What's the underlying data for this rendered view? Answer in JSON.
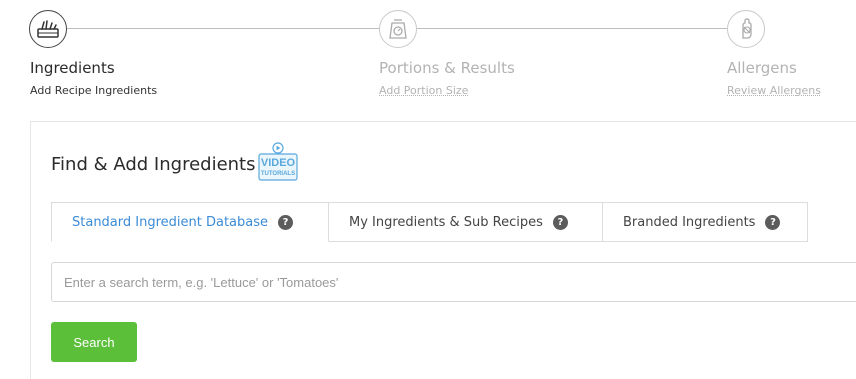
{
  "stepper": {
    "steps": [
      {
        "title": "Ingredients",
        "subtitle": "Add Recipe Ingredients",
        "icon": "chef-board-icon",
        "state": "active"
      },
      {
        "title": "Portions & Results",
        "subtitle": "Add Portion Size",
        "icon": "scale-icon",
        "state": "inactive"
      },
      {
        "title": "Allergens",
        "subtitle": "Review Allergens",
        "icon": "allergen-hand-icon",
        "state": "inactive"
      }
    ]
  },
  "finder": {
    "title": "Find & Add Ingredients",
    "video_badge": {
      "line1": "VIDEO",
      "line2": "TUTORIALS",
      "icon": "play-icon"
    },
    "tabs": [
      {
        "label": "Standard Ingredient Database",
        "active": true
      },
      {
        "label": "My Ingredients & Sub Recipes",
        "active": false
      },
      {
        "label": "Branded Ingredients",
        "active": false
      }
    ],
    "help_glyph": "?",
    "search": {
      "placeholder": "Enter a search term, e.g. 'Lettuce' or 'Tomatoes'",
      "value": ""
    },
    "search_button": "Search"
  },
  "colors": {
    "accent_blue": "#3b8bd6",
    "search_green": "#5cbf3a",
    "inactive_text": "#b3b3b3"
  }
}
